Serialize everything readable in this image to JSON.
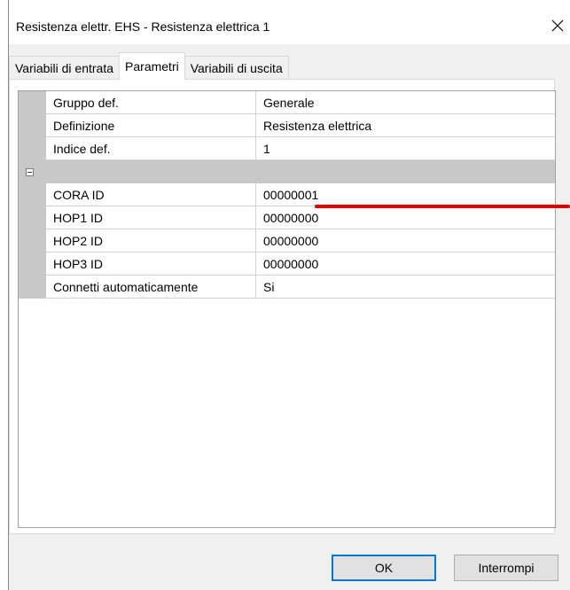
{
  "window": {
    "title": "Resistenza elettr. EHS - Resistenza elettrica 1"
  },
  "tabs": [
    {
      "label": "Variabili di entrata",
      "active": false
    },
    {
      "label": "Parametri",
      "active": true
    },
    {
      "label": "Variabili di uscita",
      "active": false
    }
  ],
  "grid": {
    "group1": [
      {
        "name": "Gruppo def.",
        "value": "Generale"
      },
      {
        "name": "Definizione",
        "value": "Resistenza elettrica"
      },
      {
        "name": "Indice def.",
        "value": "1"
      }
    ],
    "category_toggle": "collapse",
    "group2": [
      {
        "name": "CORA ID",
        "value": "00000001"
      },
      {
        "name": "HOP1 ID",
        "value": "00000000"
      },
      {
        "name": "HOP2 ID",
        "value": "00000000"
      },
      {
        "name": "HOP3 ID",
        "value": "00000000"
      },
      {
        "name": "Connetti automaticamente",
        "value": "Si"
      }
    ]
  },
  "annotation": {
    "color": "#e00000"
  },
  "buttons": {
    "ok": "OK",
    "cancel": "Interrompi"
  },
  "icons": {
    "close": "close-icon",
    "toggle": "minus-box-icon"
  }
}
